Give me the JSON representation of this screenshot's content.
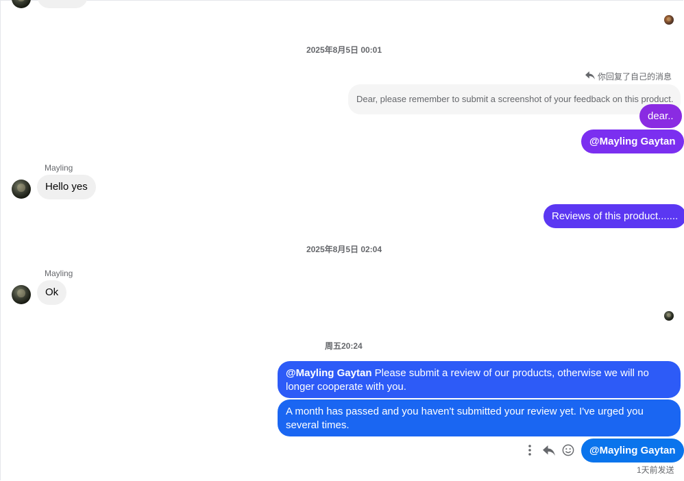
{
  "colors": {
    "incoming_bg": "#f0f0f0",
    "purple_1": "#7b2ff0",
    "purple_2": "#5b37f2",
    "blue_1": "#2d5bf7",
    "blue_2": "#1a66f2",
    "blue_3": "#0a74ec"
  },
  "messages": {
    "top_partial_bubble": "",
    "ts1": "2025年8月5日 00:01",
    "reply_note": "你回复了自己的消息",
    "quoted_text": "Dear, please remember to submit a screenshot of your feedback on this product.",
    "out_dear": "dear..",
    "out_mention1": "@Mayling Gaytan",
    "sender1": "Mayling",
    "in_hello": "Hello yes",
    "out_reviews": "Reviews of this product.......",
    "ts2": "2025年8月5日 02:04",
    "sender2": "Mayling",
    "in_ok": "Ok",
    "ts3": "周五20:24",
    "out_submit_mention": "@Mayling Gaytan",
    "out_submit_text": " Please submit a review of our products, otherwise we will no longer cooperate with you.",
    "out_month": "A month has passed and you haven't submitted your review yet. I've urged you several times.",
    "out_mention2": "@Mayling Gaytan",
    "sent_status": "1天前发送"
  },
  "icons": {
    "more": "more-vertical-icon",
    "reply": "reply-icon",
    "react": "emoji-icon"
  }
}
